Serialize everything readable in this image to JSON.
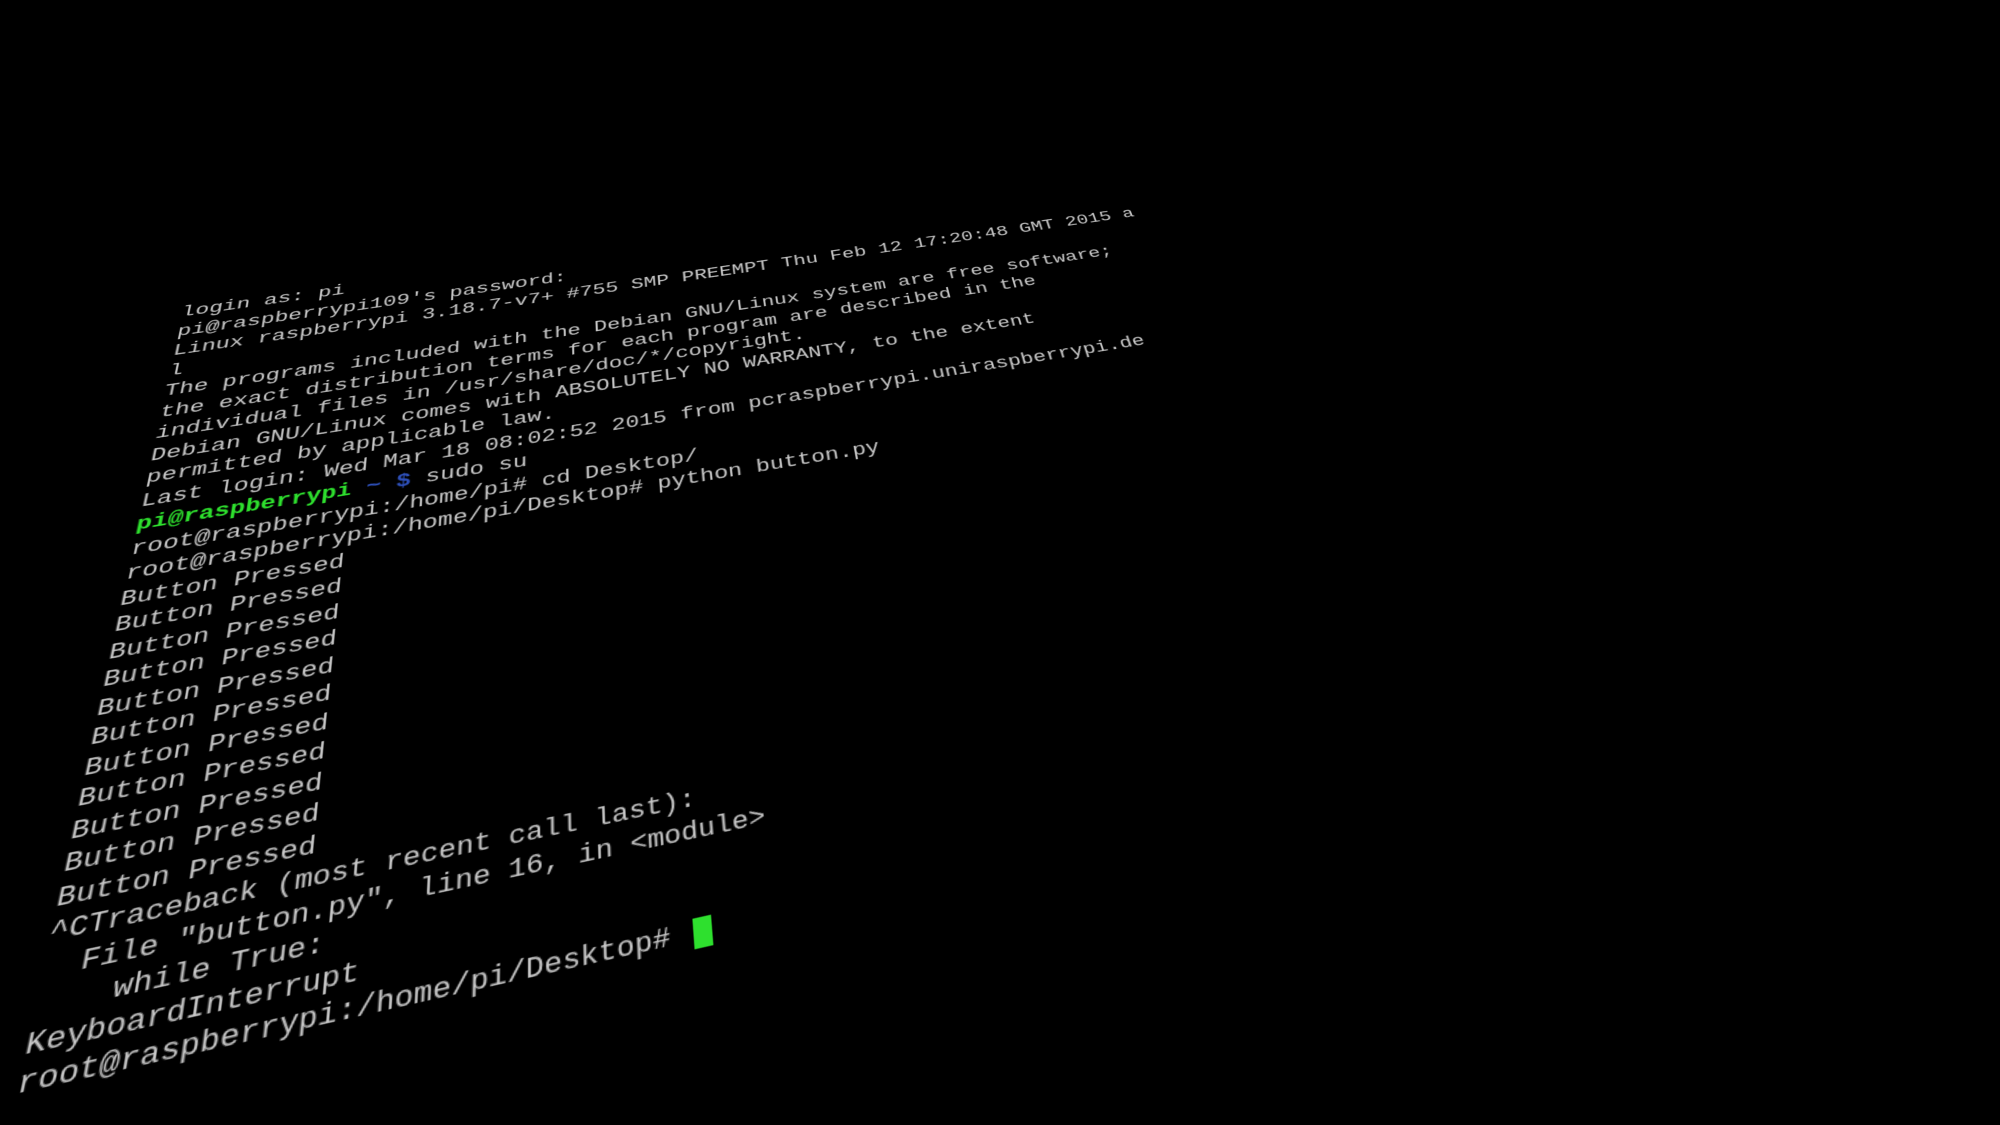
{
  "terminal": {
    "lines": [
      {
        "segments": [
          {
            "text": "login as: pi",
            "class": ""
          }
        ]
      },
      {
        "segments": [
          {
            "text": "pi@raspberrypi109's password:",
            "class": ""
          }
        ]
      },
      {
        "segments": [
          {
            "text": "Linux raspberrypi 3.18.7-v7+ #755 SMP PREEMPT Thu Feb 12 17:20:48 GMT 2015 a",
            "class": ""
          }
        ]
      },
      {
        "segments": [
          {
            "text": "l",
            "class": ""
          }
        ]
      },
      {
        "segments": [
          {
            "text": "",
            "class": ""
          }
        ]
      },
      {
        "segments": [
          {
            "text": "The programs included with the Debian GNU/Linux system are free software;",
            "class": ""
          }
        ]
      },
      {
        "segments": [
          {
            "text": "the exact distribution terms for each program are described in the",
            "class": ""
          }
        ]
      },
      {
        "segments": [
          {
            "text": "individual files in /usr/share/doc/*/copyright.",
            "class": ""
          }
        ]
      },
      {
        "segments": [
          {
            "text": "",
            "class": ""
          }
        ]
      },
      {
        "segments": [
          {
            "text": "Debian GNU/Linux comes with ABSOLUTELY NO WARRANTY, to the extent",
            "class": ""
          }
        ]
      },
      {
        "segments": [
          {
            "text": "permitted by applicable law.",
            "class": ""
          }
        ]
      },
      {
        "segments": [
          {
            "text": "Last login: Wed Mar 18 08:02:52 2015 from pcraspberrypi.uniraspberrypi.de",
            "class": ""
          }
        ]
      },
      {
        "segments": [
          {
            "text": "pi@raspberrypi",
            "class": "green"
          },
          {
            "text": " ",
            "class": ""
          },
          {
            "text": "~ $",
            "class": "blue"
          },
          {
            "text": " sudo su",
            "class": ""
          }
        ]
      },
      {
        "segments": [
          {
            "text": "root@raspberrypi:/home/pi# cd Desktop/",
            "class": ""
          }
        ]
      },
      {
        "segments": [
          {
            "text": "root@raspberrypi:/home/pi/Desktop# python button.py",
            "class": ""
          }
        ]
      },
      {
        "segments": [
          {
            "text": "Button Pressed",
            "class": ""
          }
        ]
      },
      {
        "segments": [
          {
            "text": "Button Pressed",
            "class": ""
          }
        ]
      },
      {
        "segments": [
          {
            "text": "Button Pressed",
            "class": ""
          }
        ]
      },
      {
        "segments": [
          {
            "text": "Button Pressed",
            "class": ""
          }
        ]
      },
      {
        "segments": [
          {
            "text": "Button Pressed",
            "class": ""
          }
        ]
      },
      {
        "segments": [
          {
            "text": "Button Pressed",
            "class": ""
          }
        ]
      },
      {
        "segments": [
          {
            "text": "Button Pressed",
            "class": ""
          }
        ]
      },
      {
        "segments": [
          {
            "text": "Button Pressed",
            "class": ""
          }
        ]
      },
      {
        "segments": [
          {
            "text": "Button Pressed",
            "class": ""
          }
        ]
      },
      {
        "segments": [
          {
            "text": "Button Pressed",
            "class": ""
          }
        ]
      },
      {
        "segments": [
          {
            "text": "Button Pressed",
            "class": ""
          }
        ]
      },
      {
        "segments": [
          {
            "text": "^CTraceback (most recent call last):",
            "class": ""
          }
        ]
      },
      {
        "segments": [
          {
            "text": "  File \"button.py\", line 16, in <module>",
            "class": ""
          }
        ]
      },
      {
        "segments": [
          {
            "text": "    while True:",
            "class": ""
          }
        ]
      },
      {
        "segments": [
          {
            "text": "KeyboardInterrupt",
            "class": ""
          }
        ]
      },
      {
        "segments": [
          {
            "text": "root@raspberrypi:/home/pi/Desktop# ",
            "class": ""
          }
        ],
        "cursor": true
      }
    ]
  }
}
